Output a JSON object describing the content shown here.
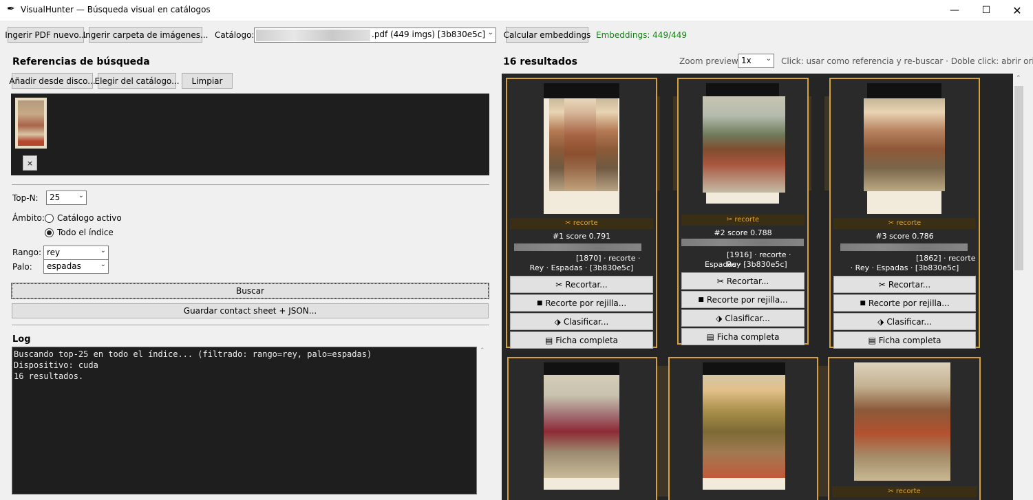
{
  "window": {
    "title": "VisualHunter — Búsqueda visual en catálogos",
    "minimize_icon": "minimize-icon",
    "maximize_icon": "maximize-icon",
    "close_icon": "close-icon",
    "app_icon": "feather-icon"
  },
  "toolbar": {
    "ingest_pdf": "Ingerir PDF nuevo...",
    "ingest_folder": "Ingerir carpeta de imágenes...",
    "catalog_label": "Catálogo:",
    "catalog_value": ".pdf  (449 imgs)  [3b830e5c]",
    "compute_embeddings": "Calcular embeddings",
    "embeddings_status": "Embeddings: 449/449",
    "embeddings_color": "#1a7f1a"
  },
  "refs": {
    "title": "Referencias de búsqueda",
    "add_disk": "Añadir desde disco...",
    "choose_catalog": "Elegir del catálogo...",
    "clear": "Limpiar",
    "remove": "×"
  },
  "filters": {
    "topn_label": "Top-N:",
    "topn_value": "25",
    "scope_label": "Ámbito:",
    "scope_active": "Catálogo activo",
    "scope_all": "Todo el índice",
    "scope_selected": "all",
    "rank_label": "Rango:",
    "rank_value": "rey",
    "suit_label": "Palo:",
    "suit_value": "espadas",
    "search": "Buscar",
    "save": "Guardar contact sheet + JSON..."
  },
  "log": {
    "title": "Log",
    "lines": [
      "Buscando top-25 en todo el índice... (filtrado: rango=rey, palo=espadas)",
      "Dispositivo: cuda",
      "16 resultados."
    ]
  },
  "results": {
    "count": "16 resultados",
    "zoom_label": "Zoom preview:",
    "zoom_value": "1x",
    "hint": "Click: usar como referencia y re-buscar  ·  Doble click: abrir original",
    "accent": "#d8a23a",
    "items": [
      {
        "tag": "✂ recorte",
        "rank": "#1  score 0.791",
        "line2": "[1870] · recorte ·",
        "line3": "Rey · Espadas · [3b830e5c]"
      },
      {
        "tag": "✂ recorte",
        "rank": "#2  score 0.788",
        "line2": "[1916] · recorte · Rey ·",
        "line3": "Espadas · [3b830e5c]"
      },
      {
        "tag": "✂ recorte",
        "rank": "#3  score 0.786",
        "line2": "[1862] · recorte",
        "line3": "· Rey · Espadas · [3b830e5c]"
      }
    ],
    "actions": {
      "crop": "Recortar...",
      "grid_crop": "Recorte por rejilla...",
      "classify": "Clasificar...",
      "sheet": "Ficha completa"
    },
    "bottom_tag": "✂ recorte"
  }
}
